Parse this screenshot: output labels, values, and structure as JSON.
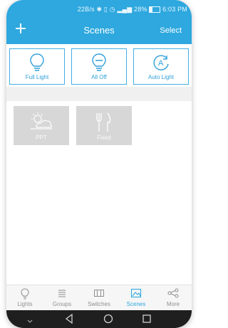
{
  "status": {
    "speed": "22B/s",
    "signal": "28%",
    "time": "6:03 PM",
    "battery_level": 0.28
  },
  "header": {
    "add_icon": "plus-icon",
    "title": "Scenes",
    "select_label": "Select"
  },
  "presets": [
    {
      "label": "Full Light",
      "icon": "lightbulb-on-icon"
    },
    {
      "label": "All Off",
      "icon": "lightbulb-off-icon"
    },
    {
      "label": "Auto Light",
      "icon": "auto-light-icon"
    }
  ],
  "scenes": [
    {
      "label": "PPT",
      "icon": "sun-cloud-icon"
    },
    {
      "label": "Fixed",
      "icon": "fork-knife-icon"
    }
  ],
  "tabs": [
    {
      "label": "Lights",
      "icon": "lightbulb-icon"
    },
    {
      "label": "Groups",
      "icon": "groups-icon"
    },
    {
      "label": "Switches",
      "icon": "switches-icon"
    },
    {
      "label": "Scenes",
      "icon": "scenes-icon",
      "active": true
    },
    {
      "label": "More",
      "icon": "share-icon"
    }
  ],
  "colors": {
    "accent": "#2ea8de",
    "card_gray": "#d7d7d7",
    "tab_inactive": "#8f8f8f"
  }
}
